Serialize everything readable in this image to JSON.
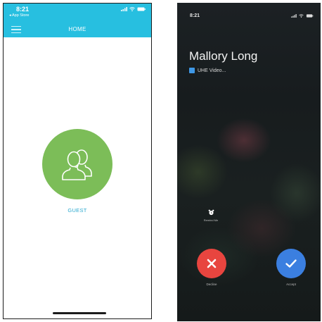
{
  "left_screen": {
    "status": {
      "time": "8:21",
      "back_label": "◂ App Store"
    },
    "navbar": {
      "title": "HOME"
    },
    "guest": {
      "label": "GUEST"
    }
  },
  "right_screen": {
    "status": {
      "time": "8:21"
    },
    "caller": {
      "name": "Mallory Long",
      "app_name": "UHE Video..."
    },
    "remind": {
      "label": "Remind Me"
    },
    "decline": {
      "label": "Decline"
    },
    "accept": {
      "label": "Accept"
    }
  },
  "colors": {
    "header": "#27bfe0",
    "guest_circle": "#7cbd58",
    "guest_label": "#2aa9cf",
    "decline": "#e8453f",
    "accept": "#3b7fe0",
    "app_badge": "#3f98e6"
  },
  "icons": [
    "hamburger-icon",
    "guest-users-icon",
    "alarm-clock-icon",
    "close-x-icon",
    "checkmark-icon",
    "signal-icon",
    "wifi-icon",
    "battery-icon",
    "app-badge-icon"
  ]
}
